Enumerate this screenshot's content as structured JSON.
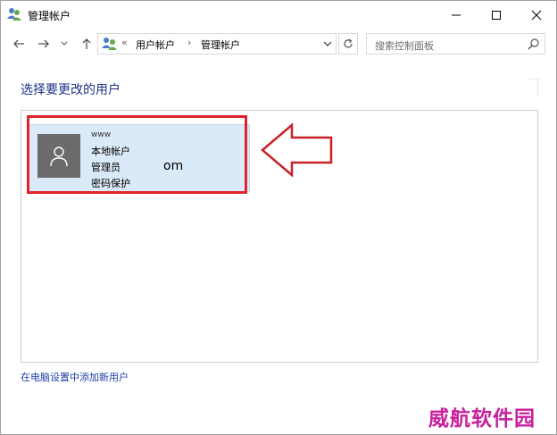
{
  "window": {
    "title": "管理帐户"
  },
  "nav": {
    "address_seg_prefix": "«",
    "address_seg1": "用户帐户",
    "address_sep": "›",
    "address_seg2": "管理帐户",
    "search_placeholder": "搜索控制面板"
  },
  "content": {
    "heading": "选择要更改的用户",
    "add_user_link": "在电脑设置中添加新用户"
  },
  "user": {
    "name_obscured": "www",
    "line1": "本地帐户",
    "line2": "管理员",
    "line3": "密码保护",
    "mail_fragment": "om"
  },
  "watermark": "威航软件园",
  "colors": {
    "accent_heading": "#1e3287",
    "link": "#1e3ea8",
    "tile_bg": "#dbeaf8",
    "highlight_red": "#e0222a",
    "watermark": "#c8219c"
  },
  "icons": {
    "title": "user-accounts-icon",
    "back": "arrow-left-icon",
    "forward": "arrow-right-icon",
    "recent": "chevron-down-icon",
    "up": "arrow-up-icon",
    "refresh": "refresh-icon",
    "search": "search-icon",
    "avatar": "user-silhouette-icon"
  }
}
